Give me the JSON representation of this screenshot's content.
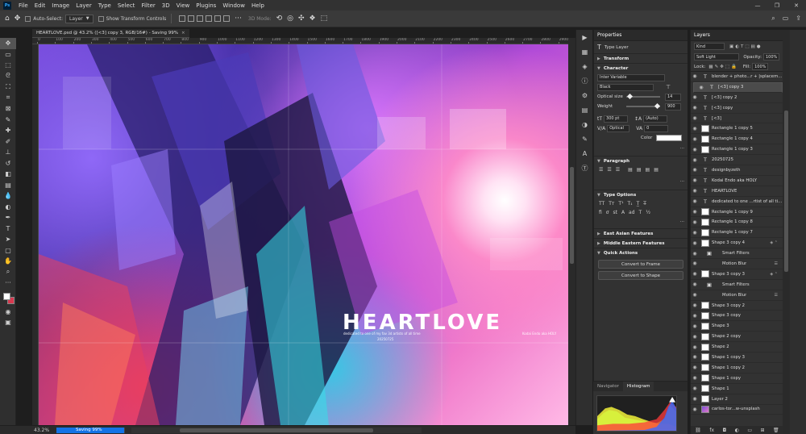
{
  "app": {
    "logo": "Ps"
  },
  "menu": [
    "File",
    "Edit",
    "Image",
    "Layer",
    "Type",
    "Select",
    "Filter",
    "3D",
    "View",
    "Plugins",
    "Window",
    "Help"
  ],
  "window_controls": {
    "min": "—",
    "max": "❐",
    "close": "✕"
  },
  "options": {
    "auto_select_label": "Auto-Select:",
    "auto_select_value": "Layer",
    "transform_label": "Show Transform Controls",
    "mode_3d": "3D Mode:"
  },
  "document": {
    "tab_title": "HEARTLOVE.psd @ 43.2% ([<3] copy 3, RGB/16#) - Saving 99%",
    "close": "×"
  },
  "ruler": {
    "ticks": [
      "0",
      "100",
      "200",
      "300",
      "400",
      "500",
      "600",
      "700",
      "800",
      "900",
      "1000",
      "1100",
      "1200",
      "1300",
      "1400",
      "1500",
      "1600",
      "1700",
      "1800",
      "1900",
      "2000",
      "2100",
      "2200",
      "2300",
      "2400",
      "2500",
      "2600",
      "2700",
      "2800",
      "2900"
    ]
  },
  "artwork": {
    "title": "HEARTLOVE",
    "subtitle": "dedicated to one of my fav 3d artists of all time",
    "date": "20250725",
    "credit": "Kodai Endo aka HOLY"
  },
  "status": {
    "zoom": "43.2%",
    "saving": "Saving 99%",
    "progress": 0.99
  },
  "properties": {
    "tab": "Properties",
    "layer_type": "Type Layer",
    "transform": "Transform",
    "character": "Character",
    "font_family": "Inter Variable",
    "font_style": "Black",
    "optical_size_label": "Optical size",
    "optical_size_value": "14",
    "weight_label": "Weight",
    "weight_value": "900",
    "font_size": "300 pt",
    "leading": "(Auto)",
    "kerning": "Optical",
    "tracking": "0",
    "color_label": "Color",
    "paragraph": "Paragraph",
    "type_options": "Type Options",
    "east_asian": "East Asian Features",
    "middle_eastern": "Middle Eastern Features",
    "quick_actions": "Quick Actions",
    "convert_frame": "Convert to Frame",
    "convert_shape": "Convert to Shape",
    "more": "..."
  },
  "navigator": {
    "tab_navigator": "Navigator",
    "tab_histogram": "Histogram"
  },
  "layers": {
    "tab": "Layers",
    "kind": "Kind",
    "blend_mode": "Soft Light",
    "opacity_label": "Opacity:",
    "opacity": "100%",
    "lock_label": "Lock:",
    "fill_label": "Fill:",
    "fill": "100%",
    "items": [
      {
        "name": "blender + photo...r + |splacement",
        "kind": "T"
      },
      {
        "name": "[<3] copy 3",
        "kind": "T",
        "selected": true
      },
      {
        "name": "[<3] copy 2",
        "kind": "T"
      },
      {
        "name": "[<3] copy",
        "kind": "T"
      },
      {
        "name": "[<3]",
        "kind": "T"
      },
      {
        "name": "Rectangle 1 copy 5",
        "kind": "shape"
      },
      {
        "name": "Rectangle 1 copy 4",
        "kind": "shape"
      },
      {
        "name": "Rectangle 1 copy 3",
        "kind": "shape"
      },
      {
        "name": "20250725",
        "kind": "T"
      },
      {
        "name": "designbyzeth",
        "kind": "T"
      },
      {
        "name": "Kodai Endo aka HOLY",
        "kind": "T"
      },
      {
        "name": "HEARTLOVE",
        "kind": "T"
      },
      {
        "name": "dedicated to one ...rtist of all time",
        "kind": "T"
      },
      {
        "name": "Rectangle 1 copy 9",
        "kind": "shape"
      },
      {
        "name": "Rectangle 1 copy 8",
        "kind": "shape"
      },
      {
        "name": "Rectangle 1 copy 7",
        "kind": "shape"
      },
      {
        "name": "Shape 3 copy 4",
        "kind": "shape",
        "fx": true
      },
      {
        "name": "Smart Filters",
        "kind": "sub"
      },
      {
        "name": "Motion Blur",
        "kind": "sub2"
      },
      {
        "name": "Shape 3 copy 3",
        "kind": "shape",
        "fx": true
      },
      {
        "name": "Smart Filters",
        "kind": "sub"
      },
      {
        "name": "Motion Blur",
        "kind": "sub2"
      },
      {
        "name": "Shape 3 copy 2",
        "kind": "shape"
      },
      {
        "name": "Shape 3 copy",
        "kind": "shape"
      },
      {
        "name": "Shape 3",
        "kind": "shape"
      },
      {
        "name": "Shape 2 copy",
        "kind": "shape"
      },
      {
        "name": "Shape 2",
        "kind": "shape"
      },
      {
        "name": "Shape 1 copy 3",
        "kind": "shape"
      },
      {
        "name": "Shape 1 copy 2",
        "kind": "shape"
      },
      {
        "name": "Shape 1 copy",
        "kind": "shape"
      },
      {
        "name": "Shape 1",
        "kind": "shape"
      },
      {
        "name": "Layer 2",
        "kind": "shape"
      },
      {
        "name": "carlos-tor...w-unsplash",
        "kind": "img"
      }
    ]
  },
  "colors": {
    "accent": "#1473e6",
    "fg": "#ffffff",
    "bg": "#d9394f"
  }
}
